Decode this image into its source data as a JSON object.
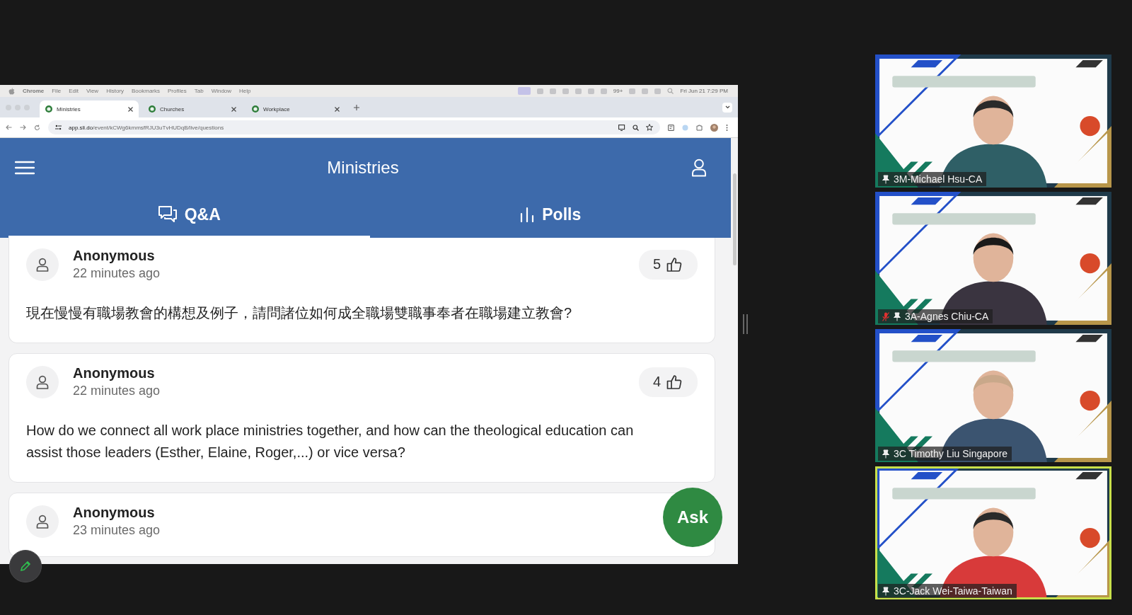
{
  "mac_menu_bar": {
    "items": [
      {
        "label": "Chrome",
        "kind": "app"
      },
      {
        "label": "File",
        "kind": "menu"
      },
      {
        "label": "Edit",
        "kind": "menu"
      },
      {
        "label": "View",
        "kind": "menu"
      },
      {
        "label": "History",
        "kind": "menu"
      },
      {
        "label": "Bookmarks",
        "kind": "menu"
      },
      {
        "label": "Profiles",
        "kind": "menu"
      },
      {
        "label": "Tab",
        "kind": "menu"
      },
      {
        "label": "Window",
        "kind": "menu"
      },
      {
        "label": "Help",
        "kind": "menu"
      }
    ],
    "notification_count": "99+",
    "clock": "Fri Jun 21  7:29 PM"
  },
  "browser": {
    "tabs": [
      {
        "title": "Ministries",
        "selected": true
      },
      {
        "title": "Churches",
        "selected": false
      },
      {
        "title": "Workplace",
        "selected": false
      }
    ],
    "url_host": "app.sli.do",
    "url_path": "/event/kCWg6kmmsfRJU3uTvHUDqB/live/questions"
  },
  "app": {
    "title": "Ministries",
    "tabs": [
      {
        "label": "Q&A",
        "kind": "qa",
        "selected": true
      },
      {
        "label": "Polls",
        "kind": "polls",
        "selected": false
      }
    ],
    "questions": [
      {
        "author": "Anonymous",
        "time": "22 minutes ago",
        "likes": "5",
        "text": "現在慢慢有職場教會的構想及例子，請問諸位如何成全職場雙職事奉者在職場建立教會?"
      },
      {
        "author": "Anonymous",
        "time": "22 minutes ago",
        "likes": "4",
        "text": "How do we connect all work place ministries together, and how can the theological education can assist those leaders (Esther, Elaine, Roger,...) or vice versa?"
      },
      {
        "author": "Anonymous",
        "time": "23 minutes ago"
      }
    ],
    "ask_button": "Ask"
  },
  "participants": [
    {
      "name": "3M-Michael Hsu-CA",
      "muted": false,
      "speaking": false
    },
    {
      "name": "3A-Agnes Chiu-CA",
      "muted": true,
      "speaking": false
    },
    {
      "name": "3C Timothy Liu Singapore",
      "muted": false,
      "speaking": false
    },
    {
      "name": "3C-Jack Wei-Taiwa-Taiwan",
      "muted": false,
      "speaking": true
    }
  ]
}
